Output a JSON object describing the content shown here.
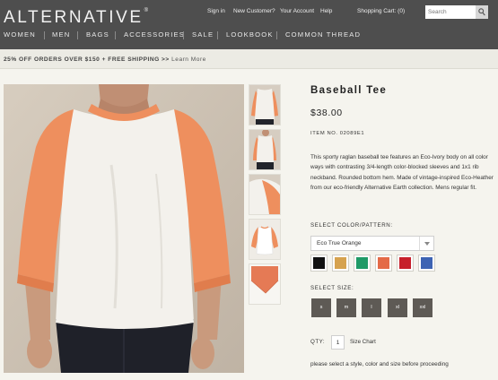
{
  "brand": {
    "logo_text": "ALTERNATIVE",
    "logo_mark": "®"
  },
  "top_links": {
    "sign_in": "Sign in",
    "new_customer": "New Customer?",
    "your_account": "Your Account",
    "help": "Help",
    "cart": "Shopping Cart: (0)"
  },
  "search": {
    "placeholder": "Search"
  },
  "nav": {
    "items": [
      "WOMEN",
      "MEN",
      "BAGS",
      "ACCESSORIES",
      "SALE",
      "LOOKBOOK",
      "COMMON THREAD"
    ]
  },
  "promo": {
    "bold_text": "25% OFF ORDERS OVER $150 + FREE SHIPPING >>",
    "link_text": "Learn More"
  },
  "product": {
    "title": "Baseball Tee",
    "price": "$38.00",
    "item_no": "ITEM NO. 02089E1",
    "description": "This sporty raglan baseball tee features an Eco-Ivory body on all color ways with contrasting 3/4-length color-blocked sleeves and 1x1 rib neckband. Rounded bottom hem. Made of vintage-inspired Eco-Heather from our eco-friendly Alternative Earth collection. Mens regular fit.",
    "color_label": "SELECT COLOR/PATTERN:",
    "selected_color": "Eco True Orange",
    "swatches": [
      {
        "name": "black",
        "color": "#111111"
      },
      {
        "name": "gold",
        "color": "#d6a24e"
      },
      {
        "name": "green",
        "color": "#1f9a67"
      },
      {
        "name": "orange",
        "color": "#e46a47"
      },
      {
        "name": "red",
        "color": "#c7202b"
      },
      {
        "name": "blue",
        "color": "#3d63b3"
      }
    ],
    "size_label": "SELECT SIZE:",
    "sizes": [
      "s",
      "m",
      "l",
      "xl",
      "xxl"
    ],
    "qty_label": "QTY:",
    "qty_value": "1",
    "size_chart": "Size Chart",
    "hint": "please select a style, color and size before proceeding"
  },
  "colors": {
    "header_bg": "#4e4e4e",
    "page_bg": "#f5f4ee",
    "size_button": "#5e5a55",
    "sleeve_orange": "#ee8f5e"
  }
}
